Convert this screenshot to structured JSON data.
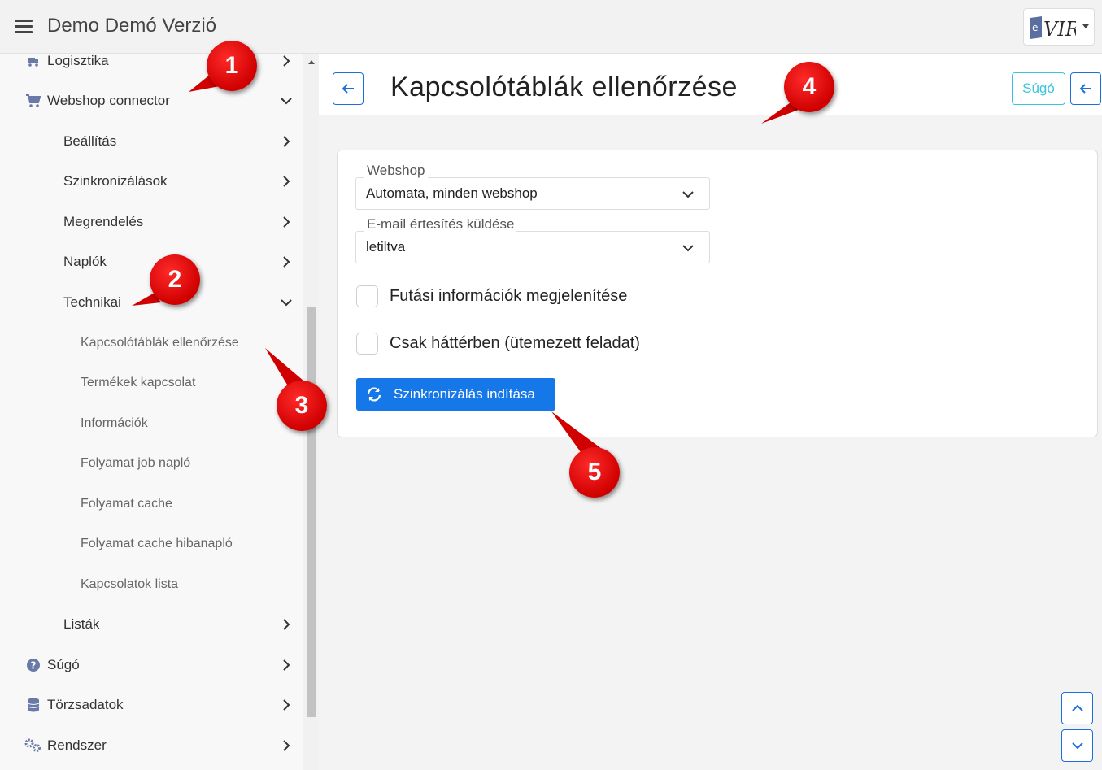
{
  "app": {
    "title": "Demo Demó Verzió",
    "logo_text": "VIR",
    "logo_letter": "e"
  },
  "sidebar": {
    "items": [
      {
        "label": "Logisztika",
        "icon": "truck-icon"
      },
      {
        "label": "Webshop connector",
        "icon": "cart-icon"
      },
      {
        "label": "Beállítás"
      },
      {
        "label": "Szinkronizálások"
      },
      {
        "label": "Megrendelés"
      },
      {
        "label": "Naplók"
      },
      {
        "label": "Technikai"
      },
      {
        "label": "Kapcsolótáblák ellenőrzése"
      },
      {
        "label": "Termékek kapcsolat"
      },
      {
        "label": "Információk"
      },
      {
        "label": "Folyamat job napló"
      },
      {
        "label": "Folyamat cache"
      },
      {
        "label": "Folyamat cache hibanapló"
      },
      {
        "label": "Kapcsolatok lista"
      },
      {
        "label": "Listák"
      },
      {
        "label": "Súgó",
        "icon": "help-circle-icon"
      },
      {
        "label": "Törzsadatok",
        "icon": "database-icon"
      },
      {
        "label": "Rendszer",
        "icon": "gears-icon"
      }
    ]
  },
  "page": {
    "title": "Kapcsolótáblák ellenőrzése",
    "help_label": "Súgó"
  },
  "form": {
    "webshop_label": "Webshop",
    "webshop_value": "Automata, minden webshop",
    "email_label": "E-mail értesítés küldése",
    "email_value": "letiltva",
    "checkbox1_label": "Futási információk megjelenítése",
    "checkbox2_label": "Csak háttérben (ütemezett feladat)",
    "sync_button_label": "Szinkronizálás indítása"
  },
  "callouts": [
    "1",
    "2",
    "3",
    "4",
    "5"
  ],
  "colors": {
    "primary": "#1577e8",
    "info": "#3cc3e2",
    "callout": "#e00000"
  }
}
